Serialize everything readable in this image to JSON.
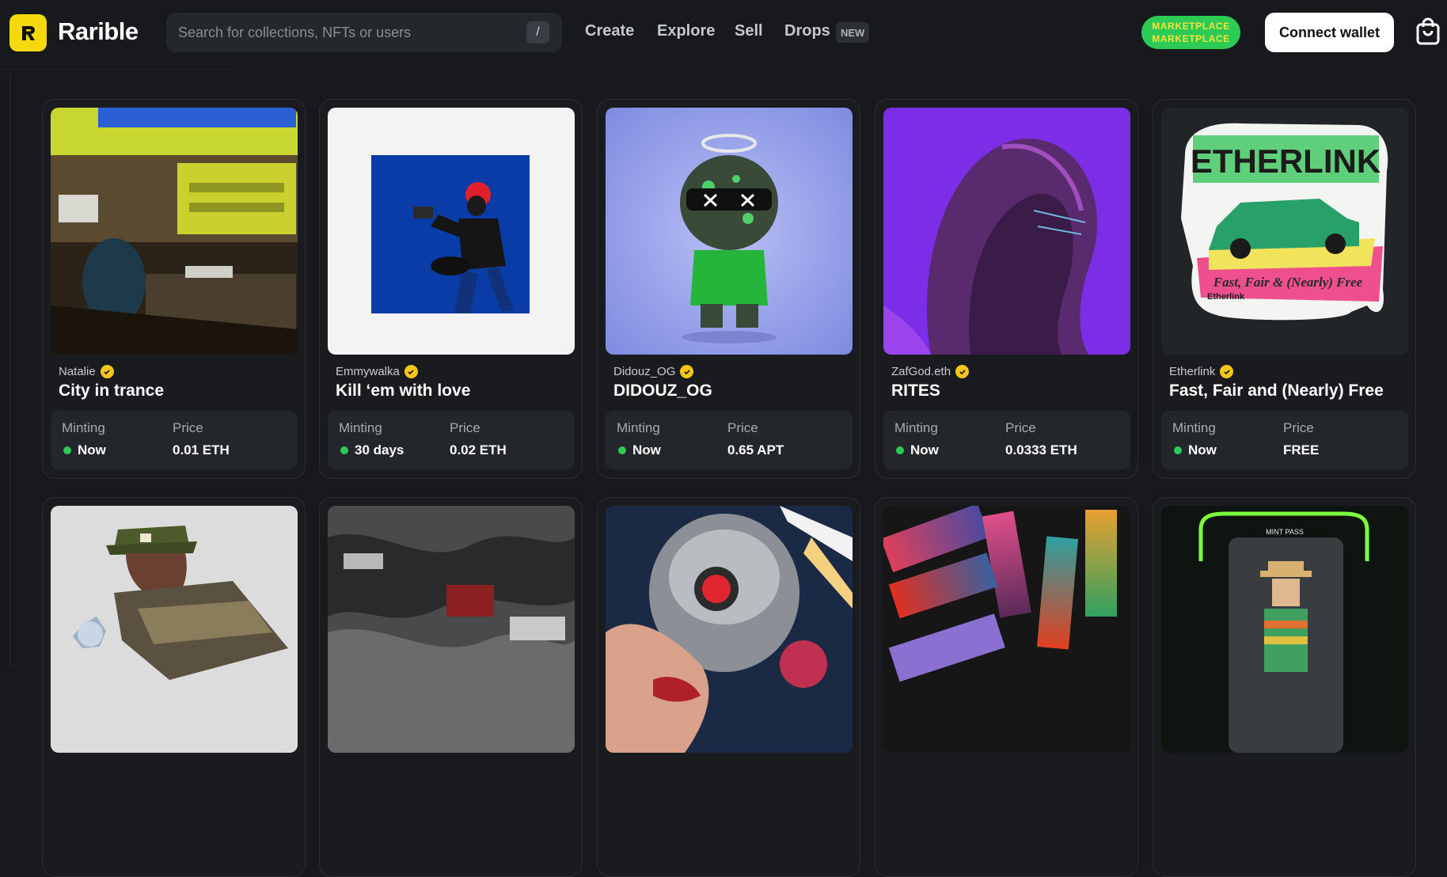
{
  "header": {
    "brand": "Rarible",
    "search_placeholder": "Search for collections, NFTs or users",
    "search_shortcut": "/",
    "nav": [
      "Create",
      "Explore",
      "Sell",
      "Drops"
    ],
    "drops_badge": "NEW",
    "marketplace_line1": "MARKETPLACE",
    "marketplace_line2": "MARKETPLACE",
    "connect_label": "Connect wallet"
  },
  "cards": [
    {
      "creator": "Natalie",
      "title": "City in trance",
      "minting_label": "Minting",
      "minting": "Now",
      "price_label": "Price",
      "price": "0.01 ETH"
    },
    {
      "creator": "Emmywalka",
      "title": "Kill ‘em with love",
      "minting_label": "Minting",
      "minting": "30 days",
      "price_label": "Price",
      "price": "0.02 ETH"
    },
    {
      "creator": "Didouz_OG",
      "title": "DIDOUZ_OG",
      "minting_label": "Minting",
      "minting": "Now",
      "price_label": "Price",
      "price": "0.65 APT"
    },
    {
      "creator": "ZafGod.eth",
      "title": "RITES",
      "minting_label": "Minting",
      "minting": "Now",
      "price_label": "Price",
      "price": "0.0333 ETH"
    },
    {
      "creator": "Etherlink",
      "title": "Fast, Fair and (Nearly) Free",
      "minting_label": "Minting",
      "minting": "Now",
      "price_label": "Price",
      "price": "FREE"
    }
  ],
  "art_text": {
    "etherlink_logo": "ETHERLINK",
    "etherlink_slogan": "Fast, Fair & (Nearly) Free",
    "etherlink_mark": "Etherlink",
    "mint_pass": "MINT PASS"
  },
  "colors": {
    "accent_yellow": "#f5d90a",
    "status_green": "#2bcb55",
    "background": "#17191c"
  }
}
